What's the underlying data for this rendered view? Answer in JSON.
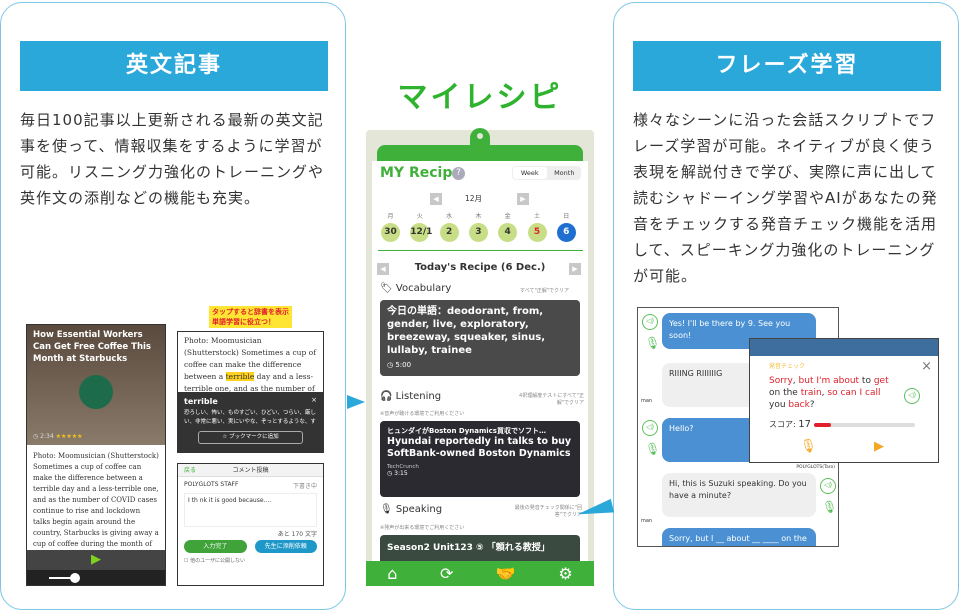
{
  "left": {
    "header": "英文記事",
    "description": "毎日100記事以上更新される最新の英文記事を使って、情報収集をするように学習が可能。リスニング力強化のトレーニングや英作文の添削などの機能も充実。",
    "article": {
      "title": "How Essential Workers Can Get Free Coffee This Month at Starbucks",
      "time": "2:34",
      "body": "Photo: Moomusician (Shutterstock) Sometimes a cup of coffee can make the difference between a terrible day and a less-terrible one, and as the number of COVID cases continue to rise and lockdown talks begin again around the country, Starbucks is giving away a cup of coffee during the month of December to anyone who is a front-"
    },
    "callout": "タップすると辞書を表示\n単語学習に役立つ！",
    "dictionary": {
      "text_before": "Photo: Moomusician (Shutterstock) Sometimes a cup of coffee can make the difference between a ",
      "highlight": "terrible",
      "text_after": " day and a less-terrible one, and as the number of COVID cases continue to",
      "word": "terrible",
      "meaning": "恐ろしい、怖い、ものすごい、ひどい、つらい、厳しい、非常に悪い、実にいやな、ぞっとするような、す",
      "bookmark": "ブックマークに追加"
    },
    "comment": {
      "back": "戻る",
      "title": "コメント投稿",
      "user": "POLYGLOTS STAFF",
      "draft": "下書き中",
      "input": "I th nk it is good because....",
      "remaining": "あと 170 文字",
      "done": "入力完了",
      "request": "先生に添削依頼",
      "private": "他のユーザに公開しない"
    }
  },
  "center": {
    "title": "マイレシピ",
    "app_title": "MY Recipe",
    "toggle": [
      "Week",
      "Month"
    ],
    "month": "12月",
    "weekdays": [
      "月",
      "火",
      "水",
      "木",
      "金",
      "土",
      "日"
    ],
    "days": [
      "30",
      "12/1",
      "2",
      "3",
      "4",
      "5",
      "6"
    ],
    "today_label": "Today's Recipe (6 Dec.)",
    "vocabulary": {
      "label": "Vocabulary",
      "note": "すべて\"正解\"でクリア",
      "card": "今日の単語：deodorant, from, gender, live, exploratory, breezeway, squeaker, sinus, lullaby, trainee",
      "time": "5:00"
    },
    "listening": {
      "label": "Listening",
      "note": "4択理解度テストにすべて\"正解\"でクリア",
      "sub": "※音声が聴ける環境でご利用ください",
      "card_jp": "ヒュンダイがBoston Dynamics買収でソフト…",
      "card_en": "Hyundai reportedly in talks to buy SoftBank-owned Boston Dynamics",
      "source": "TechCrunch",
      "time": "3:15"
    },
    "speaking": {
      "label": "Speaking",
      "note": "最後の発音チェック関係に\"回答\"でクリア",
      "sub": "※発声が出来る環境でご利用ください",
      "card": "Season2 Unit123 ⑤ 「頼れる教授」"
    }
  },
  "right": {
    "header": "フレーズ学習",
    "description": "様々なシーンに沿った会話スクリプトでフレーズ学習が可能。ネイティブが良く使う表現を解説付きで学び、実際に声に出して読むシャドーイング学習やAIがあなたの発音をチェックする発音チェック機能を活用して、スピーキング力強化のトレーニングが可能。",
    "chat": [
      "Yes! I'll be there by 9. See you soon!",
      "RIIING RIIIIIIG",
      "Hello?",
      "Hi, this is Suzuki speaking. Do you have a minute?",
      "Sorry, but I __ about __ ____ on the"
    ],
    "avatar_label": "man",
    "taro": "POLYGLOTS(Taro)",
    "check": {
      "title": "発音チェック",
      "sentence_parts": [
        [
          "Sorry",
          "r"
        ],
        [
          ", ",
          ""
        ],
        [
          "but I'm about",
          "r"
        ],
        [
          " to ",
          ""
        ],
        [
          "get",
          "r"
        ],
        [
          " on the ",
          ""
        ],
        [
          "train",
          "r"
        ],
        [
          ", ",
          ""
        ],
        [
          "so can I call",
          "r"
        ],
        [
          " you ",
          ""
        ],
        [
          "back",
          "r"
        ],
        [
          "?",
          ""
        ]
      ],
      "score_label": "スコア:",
      "score": "17",
      "score_fraction": 0.17
    }
  },
  "colors": {
    "accent_blue": "#2aa8d9",
    "green": "#3fb03a",
    "red": "#e0202a",
    "today": "#1e6fd0"
  }
}
